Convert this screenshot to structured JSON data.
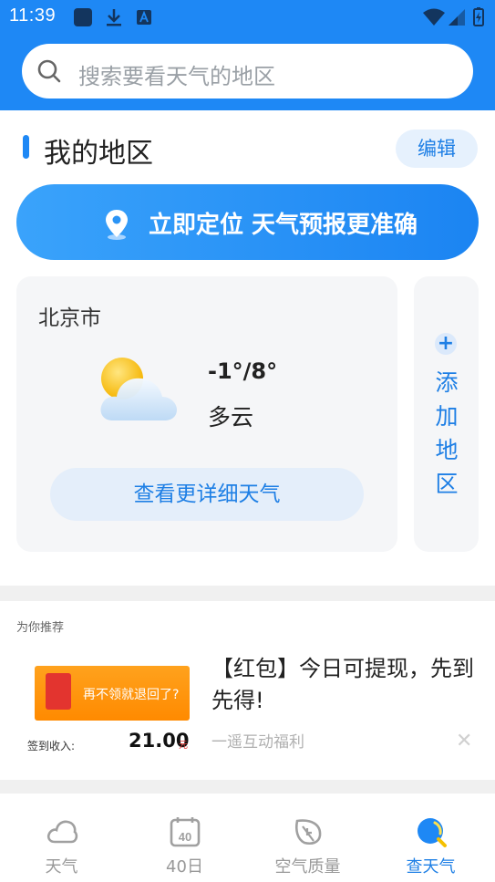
{
  "status_bar": {
    "time": "11:39"
  },
  "search": {
    "placeholder": "搜索要看天气的地区"
  },
  "my_region": {
    "title": "我的地区",
    "edit_label": "编辑",
    "locate_label": "立即定位 天气预报更准确"
  },
  "city_card": {
    "city": "北京市",
    "temperature": "-1°/8°",
    "condition": "多云",
    "detail_label": "查看更详细天气",
    "weather_icon": "partly-cloudy-icon"
  },
  "add_region": {
    "plus": "+",
    "label": "添加地区"
  },
  "ad": {
    "tag": "为你推荐",
    "title": "【红包】今日可提现，先到先得!",
    "source": "一遥互动福利",
    "close": "✕",
    "banner_text": "再不领就退回了?",
    "income_label": "签到收入:",
    "income_value": "21.00",
    "income_unit": "元"
  },
  "bottom_nav": {
    "items": [
      {
        "label": "天气",
        "icon": "cloud-icon",
        "active": false
      },
      {
        "label": "40日",
        "icon": "calendar-40-icon",
        "active": false
      },
      {
        "label": "空气质量",
        "icon": "leaf-icon",
        "active": false
      },
      {
        "label": "查天气",
        "icon": "search-weather-icon",
        "active": true
      }
    ]
  },
  "colors": {
    "accent": "#1e88f5",
    "accent_text": "#1e7fe5",
    "card_bg": "#f5f6f8"
  }
}
